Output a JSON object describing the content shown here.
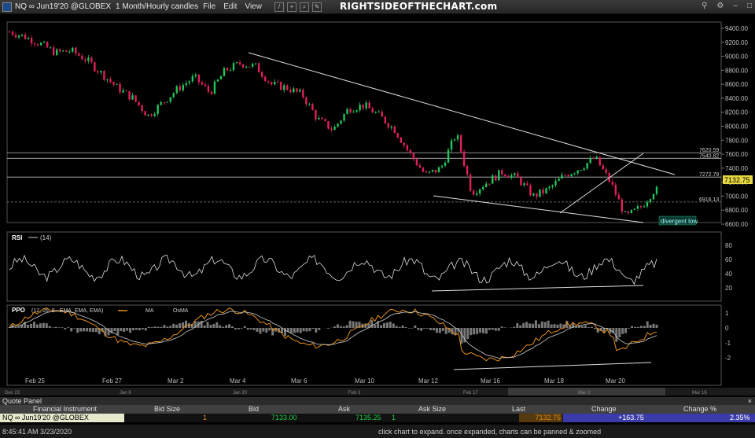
{
  "window": {
    "symbol_title": "NQ ∞ Jun19'20 @GLOBEX",
    "timeframe": "1 Month/Hourly candles",
    "menu": [
      "File",
      "Edit",
      "View"
    ],
    "brand": "RIGHTSIDEOFTHECHART.com"
  },
  "chart_data": {
    "type": "candlestick",
    "price_axis": {
      "ticks": [
        "9400.00",
        "9200.00",
        "9000.00",
        "8800.00",
        "8600.00",
        "8400.00",
        "8200.00",
        "8000.00",
        "7800.00",
        "7600.00",
        "7400.00",
        "7200.00",
        "7000.00",
        "6800.00",
        "6600.00"
      ],
      "ylim": [
        6550,
        9450
      ]
    },
    "current_price": "7132.75",
    "horizontal_levels": [
      {
        "label": "7620.59",
        "value": 7620.59
      },
      {
        "label": "7540.82",
        "value": 7540.82
      },
      {
        "label": "7272.79",
        "value": 7272.79
      },
      {
        "label": "6916.13",
        "value": 6916.13
      }
    ],
    "annotation": "divergent low",
    "x_labels": [
      "Feb 25",
      "Feb 27",
      "Mar 2",
      "Mar 4",
      "Mar 6",
      "Mar 10",
      "Mar 12",
      "Mar 16",
      "Mar 18",
      "Mar 20"
    ],
    "scroll_labels": [
      "Dec 23",
      "Jan 6",
      "Jan 20",
      "Feb 3",
      "Feb 17",
      "Mar 2",
      "Mar 16"
    ],
    "close_path": [
      [
        "Feb 24",
        9350
      ],
      [
        "Feb 24",
        9280
      ],
      [
        "Feb 25",
        9180
      ],
      [
        "Feb 25",
        9050
      ],
      [
        "Feb 26",
        9080
      ],
      [
        "Feb 26",
        8950
      ],
      [
        "Feb 27",
        8750
      ],
      [
        "Feb 27",
        8550
      ],
      [
        "Feb 28",
        8400
      ],
      [
        "Feb 28",
        8150
      ],
      [
        "Mar 2",
        8350
      ],
      [
        "Mar 2",
        8550
      ],
      [
        "Mar 3",
        8700
      ],
      [
        "Mar 3",
        8480
      ],
      [
        "Mar 4",
        8800
      ],
      [
        "Mar 4",
        8900
      ],
      [
        "Mar 5",
        8850
      ],
      [
        "Mar 5",
        8600
      ],
      [
        "Mar 6",
        8550
      ],
      [
        "Mar 6",
        8450
      ],
      [
        "Mar 9",
        8100
      ],
      [
        "Mar 9",
        7950
      ],
      [
        "Mar 10",
        8250
      ],
      [
        "Mar 10",
        8300
      ],
      [
        "Mar 11",
        8150
      ],
      [
        "Mar 11",
        7950
      ],
      [
        "Mar 12",
        7600
      ],
      [
        "Mar 12",
        7300
      ],
      [
        "Mar 13",
        7400
      ],
      [
        "Mar 13",
        7900
      ],
      [
        "Mar 16",
        7050
      ],
      [
        "Mar 16",
        7200
      ],
      [
        "Mar 17",
        7350
      ],
      [
        "Mar 17",
        7250
      ],
      [
        "Mar 18",
        7000
      ],
      [
        "Mar 18",
        7100
      ],
      [
        "Mar 19",
        7300
      ],
      [
        "Mar 19",
        7400
      ],
      [
        "Mar 20",
        7550
      ],
      [
        "Mar 20",
        7200
      ],
      [
        "Mar 22",
        6700
      ],
      [
        "Mar 23",
        6850
      ],
      [
        "Mar 23",
        7132.75
      ]
    ],
    "rsi": {
      "label": "RSI",
      "params": "(14)",
      "ticks": [
        "80",
        "60",
        "40",
        "20"
      ]
    },
    "ppo": {
      "label": "PPO",
      "params": "(12, 26, 9 - EMA, EMA, EMA)",
      "legend": [
        "MA",
        "OsMA"
      ],
      "ticks": [
        "1",
        "0",
        "-1",
        "-2"
      ]
    }
  },
  "quote_panel": {
    "title": "Quote Panel",
    "columns": [
      "Financial Instrument",
      "Bid Size",
      "Bid",
      "Ask",
      "Ask Size",
      "Last",
      "Change",
      "Change %"
    ],
    "row": {
      "instrument": "NQ ∞ Jun19'20 @GLOBEX",
      "bid_size": "1",
      "bid": "7133.00",
      "ask": "7135.25",
      "ask_size": "1",
      "last": "7132.75",
      "change": "+163.75",
      "change_pct": "2.35%"
    },
    "colors": {
      "positive": "#22cc44",
      "last": "#e08a1a",
      "change_bg": "#3a3aa8"
    }
  },
  "status": {
    "timestamp": "8:45:41 AM 3/23/2020",
    "hint": "click chart to expand. once expanded, charts can be panned & zoomed"
  }
}
